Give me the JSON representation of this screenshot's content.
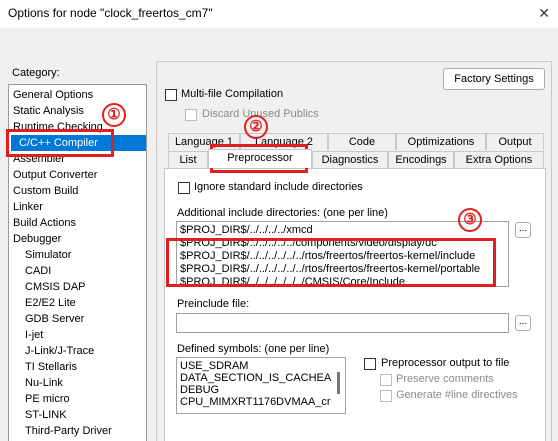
{
  "window": {
    "title": "Options for node \"clock_freertos_cm7\"",
    "close_glyph": "✕"
  },
  "category": {
    "label": "Category:",
    "items": [
      {
        "label": "General Options",
        "sub": false
      },
      {
        "label": "Static Analysis",
        "sub": false
      },
      {
        "label": "Runtime Checking",
        "sub": false
      },
      {
        "label": "C/C++ Compiler",
        "sub": false,
        "selected": true
      },
      {
        "label": "Assembler",
        "sub": false
      },
      {
        "label": "Output Converter",
        "sub": false
      },
      {
        "label": "Custom Build",
        "sub": false
      },
      {
        "label": "Linker",
        "sub": false
      },
      {
        "label": "Build Actions",
        "sub": false
      },
      {
        "label": "Debugger",
        "sub": false
      },
      {
        "label": "Simulator",
        "sub": true
      },
      {
        "label": "CADI",
        "sub": true
      },
      {
        "label": "CMSIS DAP",
        "sub": true
      },
      {
        "label": "E2/E2 Lite",
        "sub": true
      },
      {
        "label": "GDB Server",
        "sub": true
      },
      {
        "label": "I-jet",
        "sub": true
      },
      {
        "label": "J-Link/J-Trace",
        "sub": true
      },
      {
        "label": "TI Stellaris",
        "sub": true
      },
      {
        "label": "Nu-Link",
        "sub": true
      },
      {
        "label": "PE micro",
        "sub": true
      },
      {
        "label": "ST-LINK",
        "sub": true
      },
      {
        "label": "Third-Party Driver",
        "sub": true
      }
    ]
  },
  "factory_settings": "Factory Settings",
  "multifile": "Multi-file Compilation",
  "discard_unused": "Discard Unused Publics",
  "tabs_row1": [
    "Language 1",
    "Language 2",
    "Code",
    "Optimizations",
    "Output"
  ],
  "tabs_row2": [
    "List",
    "Preprocessor",
    "Diagnostics",
    "Encodings",
    "Extra Options"
  ],
  "ignore_std": "Ignore standard include directories",
  "include_label": "Additional include directories: (one per line)",
  "include_lines": [
    "$PROJ_DIR$/../../../../xmcd",
    "$PROJ_DIR$/../../../../../components/video/display/dc",
    "$PROJ_DIR$/../../../../../../rtos/freertos/freertos-kernel/include",
    "$PROJ_DIR$/../../../../../../rtos/freertos/freertos-kernel/portable",
    "$PROJ_DIR$/../../../../../../CMSIS/Core/Include"
  ],
  "ellipsis": "...",
  "preinclude_label": "Preinclude file:",
  "preinclude_value": "",
  "defined_label": "Defined symbols: (one per line)",
  "defined_lines": [
    "USE_SDRAM",
    "DATA_SECTION_IS_CACHEA",
    "DEBUG",
    "CPU_MIMXRT1176DVMAA_cr"
  ],
  "pp_output": "Preprocessor output to file",
  "preserve_comments": "Preserve comments",
  "generate_line": "Generate #line directives",
  "annotations": [
    "①",
    "②",
    "③"
  ],
  "colors": {
    "accent": "#0078d7",
    "annotation": "#e02020"
  }
}
